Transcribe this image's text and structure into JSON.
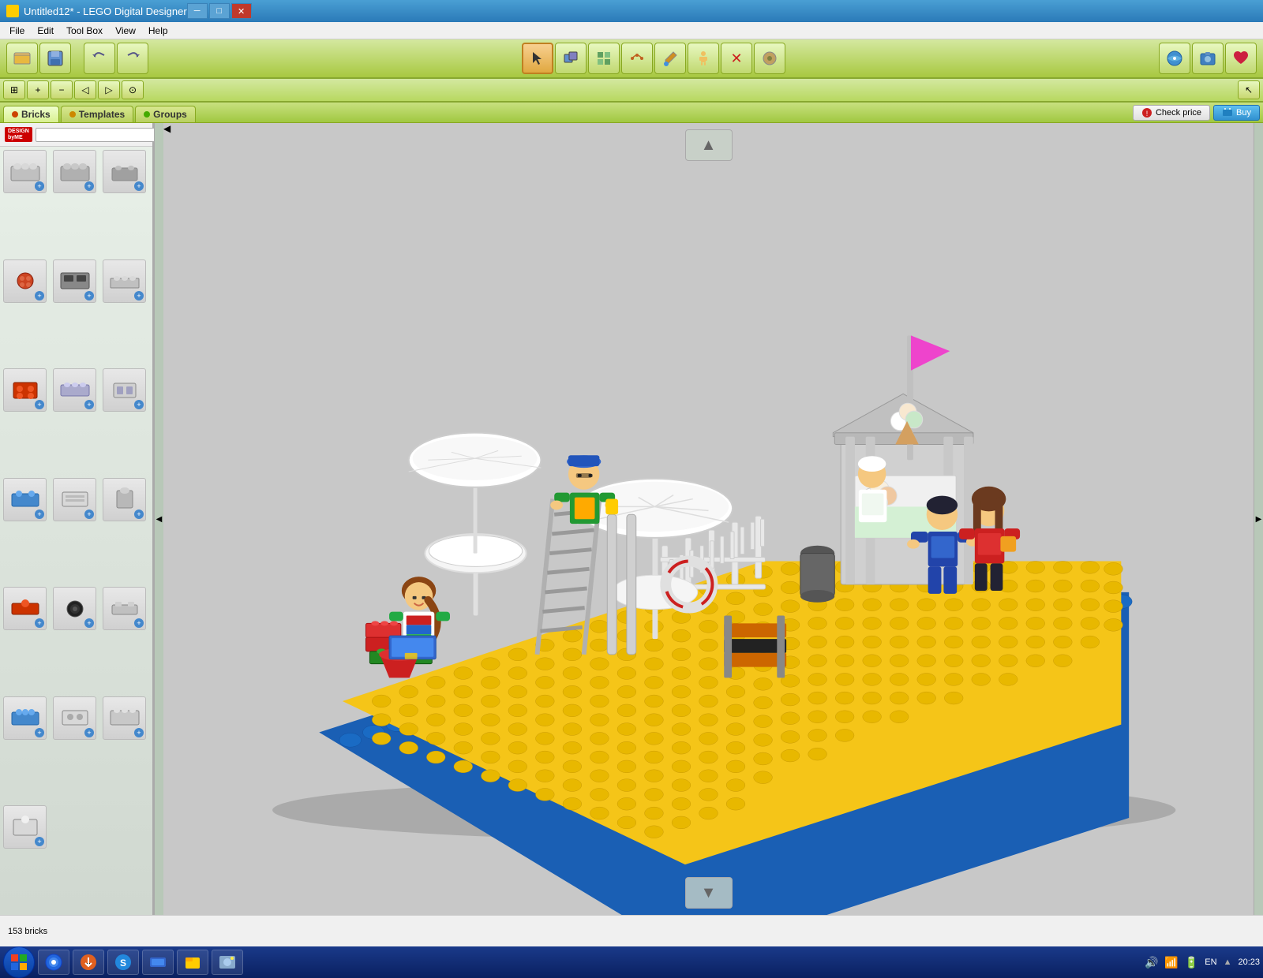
{
  "titlebar": {
    "title": "Untitled12* - LEGO Digital Designer",
    "min_label": "─",
    "max_label": "□",
    "close_label": "✕"
  },
  "menubar": {
    "items": [
      "File",
      "Edit",
      "Tool Box",
      "View",
      "Help"
    ]
  },
  "toolbar": {
    "tools": [
      {
        "name": "open",
        "icon": "📂"
      },
      {
        "name": "save",
        "icon": "💾"
      },
      {
        "name": "undo",
        "icon": "↩"
      },
      {
        "name": "redo",
        "icon": "↪"
      },
      {
        "name": "select",
        "icon": "↖"
      },
      {
        "name": "clone",
        "icon": "⧉"
      },
      {
        "name": "hinge",
        "icon": "⊞"
      },
      {
        "name": "flexible",
        "icon": "〰"
      },
      {
        "name": "paint",
        "icon": "🎨"
      },
      {
        "name": "minifig",
        "icon": "👤"
      },
      {
        "name": "delete",
        "icon": "✕"
      },
      {
        "name": "misc",
        "icon": "⊙"
      }
    ],
    "right_tools": [
      {
        "name": "share1",
        "icon": "🌐"
      },
      {
        "name": "share2",
        "icon": "📷"
      },
      {
        "name": "share3",
        "icon": "❤"
      }
    ]
  },
  "toolbar2": {
    "left_tools": [
      {
        "name": "zoom-fit",
        "icon": "⊞"
      },
      {
        "name": "zoom-in",
        "icon": "+"
      },
      {
        "name": "zoom-out",
        "icon": "−"
      },
      {
        "name": "pan-left",
        "icon": "◁"
      },
      {
        "name": "pan-right",
        "icon": "▷"
      },
      {
        "name": "center",
        "icon": "⊙"
      }
    ],
    "right_tools": [
      {
        "name": "cursor-mode",
        "icon": "↖"
      }
    ]
  },
  "tabbar": {
    "tabs": [
      {
        "label": "Bricks",
        "color": "#cc4400",
        "active": true
      },
      {
        "label": "Templates",
        "color": "#cc8800",
        "active": false
      },
      {
        "label": "Groups",
        "color": "#44aa00",
        "active": false
      }
    ],
    "check_price_label": "Check price",
    "buy_label": "Buy"
  },
  "leftpanel": {
    "logo_text": "DESIGN byME",
    "search_placeholder": "",
    "bricks": [
      {
        "icon": "🟫",
        "id": "brick-1"
      },
      {
        "icon": "⬜",
        "id": "brick-2"
      },
      {
        "icon": "🔲",
        "id": "brick-3"
      },
      {
        "icon": "🔴",
        "id": "brick-4"
      },
      {
        "icon": "⬛",
        "id": "brick-5"
      },
      {
        "icon": "🔳",
        "id": "brick-6"
      },
      {
        "icon": "🟥",
        "id": "brick-7"
      },
      {
        "icon": "⬜",
        "id": "brick-8"
      },
      {
        "icon": "🔲",
        "id": "brick-9"
      },
      {
        "icon": "🔵",
        "id": "brick-10"
      },
      {
        "icon": "⬜",
        "id": "brick-11"
      },
      {
        "icon": "▪",
        "id": "brick-12"
      },
      {
        "icon": "🔴",
        "id": "brick-13"
      },
      {
        "icon": "⚫",
        "id": "brick-14"
      },
      {
        "icon": "🔲",
        "id": "brick-15"
      },
      {
        "icon": "🔵",
        "id": "brick-16"
      },
      {
        "icon": "⬜",
        "id": "brick-17"
      },
      {
        "icon": "🔲",
        "id": "brick-18"
      },
      {
        "icon": "⬜",
        "id": "brick-19"
      },
      {
        "icon": "⚫",
        "id": "brick-20"
      },
      {
        "icon": "🔲",
        "id": "brick-21"
      }
    ]
  },
  "canvas": {
    "nav_up": "▲",
    "nav_down": "▼",
    "nav_left": "◀",
    "nav_right": "▶"
  },
  "statusbar": {
    "bricks_count": "153 bricks"
  },
  "taskbar": {
    "start_icon": "⊞",
    "apps": [
      "🌐",
      "🔄",
      "💬",
      "🔵",
      "📋",
      "🖼"
    ],
    "tray": {
      "lang": "EN",
      "time": "20:23"
    }
  }
}
